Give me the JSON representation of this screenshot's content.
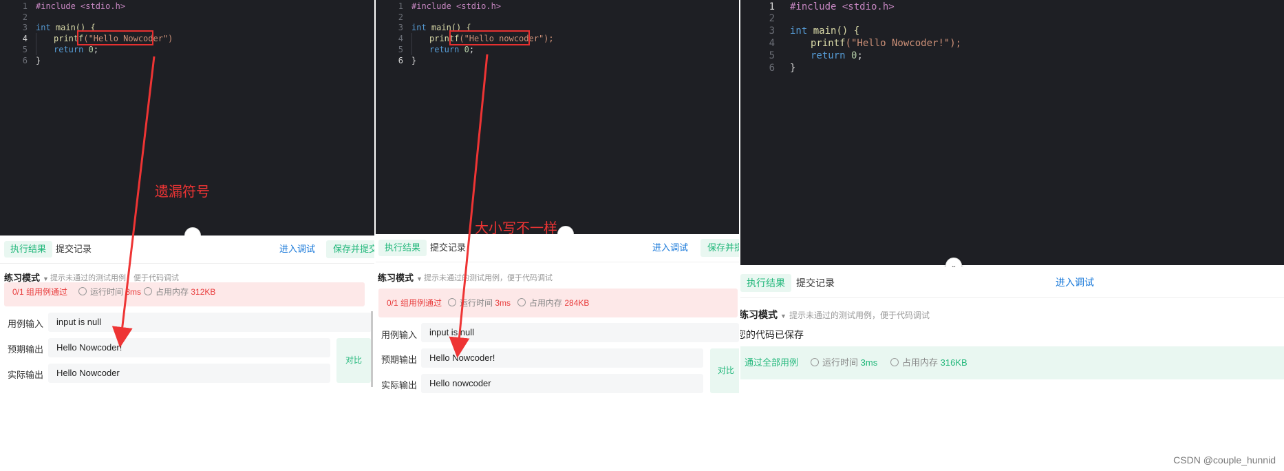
{
  "code": {
    "line_numbers": [
      "1",
      "2",
      "3",
      "4",
      "5",
      "6"
    ],
    "include": "#include <stdio.h>",
    "int_kw": "int",
    "main_sig": " main() {",
    "printf": "printf",
    "return_kw": "return",
    "zero": "0",
    "close_brace": "}"
  },
  "panels": [
    {
      "printf_args": "(\"Hello Nowcoder\")",
      "tabs": {
        "result": "执行结果",
        "history": "提交记录"
      },
      "debug_link": "进入调试",
      "save_button": "保存并提交",
      "mode_label": "练习模式",
      "mode_hint": "提示未通过的测试用例，便于代码调试",
      "status": {
        "result": "0/1 组用例通过",
        "time_label": "运行时间",
        "time_value": "3ms",
        "mem_label": "占用内存",
        "mem_value": "312KB"
      },
      "rows": [
        {
          "label": "用例输入",
          "value": "input is null"
        },
        {
          "label": "预期输出",
          "value": "Hello Nowcoder!"
        },
        {
          "label": "实际输出",
          "value": "Hello Nowcoder"
        }
      ],
      "compare_button": "对比",
      "annotation": "遗漏符号"
    },
    {
      "printf_args": "(\"Hello nowcoder\");",
      "tabs": {
        "result": "执行结果",
        "history": "提交记录"
      },
      "debug_link": "进入调试",
      "save_button": "保存并提交",
      "mode_label": "练习模式",
      "mode_hint": "提示未通过的测试用例，便于代码调试",
      "status": {
        "result": "0/1 组用例通过",
        "time_label": "运行时间",
        "time_value": "3ms",
        "mem_label": "占用内存",
        "mem_value": "284KB"
      },
      "rows": [
        {
          "label": "用例输入",
          "value": "input is null"
        },
        {
          "label": "预期输出",
          "value": "Hello Nowcoder!"
        },
        {
          "label": "实际输出",
          "value": "Hello nowcoder"
        }
      ],
      "compare_button": "对比",
      "annotation": "大小写不一样"
    },
    {
      "printf_args": "(\"Hello Nowcoder!\");",
      "tabs": {
        "result": "执行结果",
        "history": "提交记录"
      },
      "debug_link": "进入调试",
      "mode_label": "练习模式",
      "mode_hint": "提示未通过的测试用例，便于代码调试",
      "saved_text": "您的代码已保存",
      "status": {
        "result": "通过全部用例",
        "time_label": "运行时间",
        "time_value": "3ms",
        "mem_label": "占用内存",
        "mem_value": "316KB"
      }
    }
  ],
  "watermark": "CSDN @couple_hunnid",
  "colors": {
    "editor_bg": "#1e1f24",
    "accent_green": "#21b77a",
    "error_red": "#e83a3a",
    "link_blue": "#1677d9",
    "annotation_red": "#ee3434"
  }
}
